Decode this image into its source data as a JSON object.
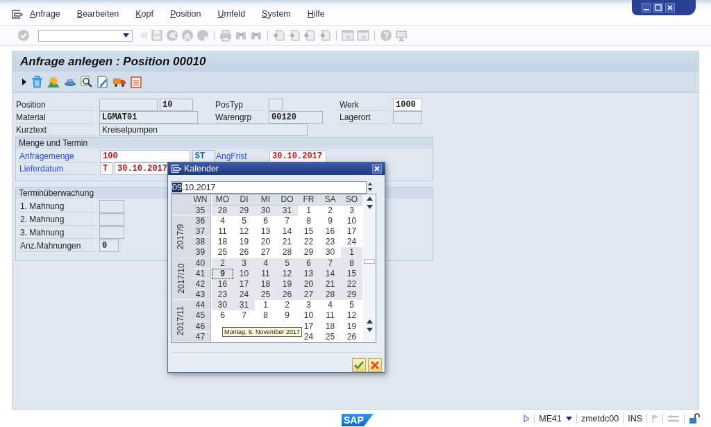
{
  "menu": [
    "Anfrage",
    "Bearbeiten",
    "Kopf",
    "Position",
    "Umfeld",
    "System",
    "Hilfe"
  ],
  "title": "Anfrage anlegen : Position 00010",
  "header": {
    "position": {
      "label": "Position",
      "value": "10"
    },
    "postyp": {
      "label": "PosTyp"
    },
    "werk": {
      "label": "Werk",
      "value": "1000",
      "editable": true
    },
    "material": {
      "label": "Material",
      "value": "LGMAT01"
    },
    "warengrp": {
      "label": "Warengrp",
      "value": "00120"
    },
    "lagerort": {
      "label": "Lagerort"
    },
    "kurztext": {
      "label": "Kurztext",
      "value": "Kreiselpumpen"
    }
  },
  "menge": {
    "title": "Menge und Termin",
    "anfragemenge": {
      "label": "Anfragemenge",
      "value": "100",
      "unit": "ST",
      "required": true
    },
    "angfrist": {
      "label": "AngFrist",
      "value": "30.10.2017",
      "required": true
    },
    "lieferdatum": {
      "label": "Lieferdatum",
      "format": "T",
      "value": "30.10.2017",
      "required": true
    }
  },
  "termin": {
    "title": "Terminüberwachung",
    "rows": [
      {
        "label": "1. Mahnung"
      },
      {
        "label": "2. Mahnung"
      },
      {
        "label": "3. Mahnung"
      },
      {
        "label": "Anz.Mahnungen",
        "value": "0"
      }
    ]
  },
  "calendar": {
    "title": "Kalender",
    "date_selected": "09",
    "date_rest": ".10.2017",
    "headers": [
      "WN",
      "MO",
      "DI",
      "MI",
      "DO",
      "FR",
      "SA",
      "SO"
    ],
    "groups": [
      {
        "weeks": [
          {
            "wn": "35",
            "days": [
              {
                "d": "28",
                "shaded": true,
                "selected": false
              },
              {
                "d": "29",
                "shaded": true,
                "selected": false
              },
              {
                "d": "30",
                "shaded": true,
                "selected": false
              },
              {
                "d": "31",
                "shaded": true,
                "selected": false
              },
              {
                "d": "1",
                "shaded": false,
                "selected": false
              },
              {
                "d": "2",
                "shaded": false,
                "selected": false
              },
              {
                "d": "3",
                "shaded": false,
                "selected": false
              }
            ]
          }
        ]
      },
      {
        "label": "2017/9",
        "weeks": [
          {
            "wn": "36",
            "days": [
              {
                "d": "4",
                "shaded": false,
                "selected": false
              },
              {
                "d": "5",
                "shaded": false,
                "selected": false
              },
              {
                "d": "6",
                "shaded": false,
                "selected": false
              },
              {
                "d": "7",
                "shaded": false,
                "selected": false
              },
              {
                "d": "8",
                "shaded": false,
                "selected": false
              },
              {
                "d": "9",
                "shaded": false,
                "selected": false
              },
              {
                "d": "10",
                "shaded": false,
                "selected": false
              }
            ]
          },
          {
            "wn": "37",
            "days": [
              {
                "d": "11",
                "shaded": false,
                "selected": false
              },
              {
                "d": "12",
                "shaded": false,
                "selected": false
              },
              {
                "d": "13",
                "shaded": false,
                "selected": false
              },
              {
                "d": "14",
                "shaded": false,
                "selected": false
              },
              {
                "d": "15",
                "shaded": false,
                "selected": false
              },
              {
                "d": "16",
                "shaded": false,
                "selected": false
              },
              {
                "d": "17",
                "shaded": false,
                "selected": false
              }
            ]
          },
          {
            "wn": "38",
            "days": [
              {
                "d": "18",
                "shaded": false,
                "selected": false
              },
              {
                "d": "19",
                "shaded": false,
                "selected": false
              },
              {
                "d": "20",
                "shaded": false,
                "selected": false
              },
              {
                "d": "21",
                "shaded": false,
                "selected": false
              },
              {
                "d": "22",
                "shaded": false,
                "selected": false
              },
              {
                "d": "23",
                "shaded": false,
                "selected": false
              },
              {
                "d": "24",
                "shaded": false,
                "selected": false
              }
            ]
          },
          {
            "wn": "39",
            "days": [
              {
                "d": "25",
                "shaded": false,
                "selected": false
              },
              {
                "d": "26",
                "shaded": false,
                "selected": false
              },
              {
                "d": "27",
                "shaded": false,
                "selected": false
              },
              {
                "d": "28",
                "shaded": false,
                "selected": false
              },
              {
                "d": "29",
                "shaded": false,
                "selected": false
              },
              {
                "d": "30",
                "shaded": false,
                "selected": false
              },
              {
                "d": "1",
                "shaded": true,
                "selected": false
              }
            ]
          }
        ]
      },
      {
        "label": "2017/10",
        "weeks": [
          {
            "wn": "40",
            "days": [
              {
                "d": "2",
                "shaded": true,
                "selected": false
              },
              {
                "d": "3",
                "shaded": true,
                "selected": false
              },
              {
                "d": "4",
                "shaded": true,
                "selected": false
              },
              {
                "d": "5",
                "shaded": true,
                "selected": false
              },
              {
                "d": "6",
                "shaded": true,
                "selected": false
              },
              {
                "d": "7",
                "shaded": true,
                "selected": false
              },
              {
                "d": "8",
                "shaded": true,
                "selected": false
              }
            ]
          },
          {
            "wn": "41",
            "days": [
              {
                "d": "9",
                "shaded": true,
                "selected": true
              },
              {
                "d": "10",
                "shaded": true,
                "selected": false
              },
              {
                "d": "11",
                "shaded": true,
                "selected": false
              },
              {
                "d": "12",
                "shaded": true,
                "selected": false
              },
              {
                "d": "13",
                "shaded": true,
                "selected": false
              },
              {
                "d": "14",
                "shaded": true,
                "selected": false
              },
              {
                "d": "15",
                "shaded": true,
                "selected": false
              }
            ]
          },
          {
            "wn": "42",
            "days": [
              {
                "d": "16",
                "shaded": true,
                "selected": false
              },
              {
                "d": "17",
                "shaded": true,
                "selected": false
              },
              {
                "d": "18",
                "shaded": true,
                "selected": false
              },
              {
                "d": "19",
                "shaded": true,
                "selected": false
              },
              {
                "d": "20",
                "shaded": true,
                "selected": false
              },
              {
                "d": "21",
                "shaded": true,
                "selected": false
              },
              {
                "d": "22",
                "shaded": true,
                "selected": false
              }
            ]
          },
          {
            "wn": "43",
            "days": [
              {
                "d": "23",
                "shaded": true,
                "selected": false
              },
              {
                "d": "24",
                "shaded": true,
                "selected": false
              },
              {
                "d": "25",
                "shaded": true,
                "selected": false
              },
              {
                "d": "26",
                "shaded": true,
                "selected": false
              },
              {
                "d": "27",
                "shaded": true,
                "selected": false
              },
              {
                "d": "28",
                "shaded": true,
                "selected": false
              },
              {
                "d": "29",
                "shaded": true,
                "selected": false
              }
            ]
          }
        ]
      },
      {
        "label": "2017/11",
        "weeks": [
          {
            "wn": "44",
            "days": [
              {
                "d": "30",
                "shaded": true,
                "selected": false
              },
              {
                "d": "31",
                "shaded": true,
                "selected": false
              },
              {
                "d": "1",
                "shaded": false,
                "selected": false
              },
              {
                "d": "2",
                "shaded": false,
                "selected": false
              },
              {
                "d": "3",
                "shaded": false,
                "selected": false
              },
              {
                "d": "4",
                "shaded": false,
                "selected": false
              },
              {
                "d": "5",
                "shaded": false,
                "selected": false
              }
            ]
          },
          {
            "wn": "45",
            "days": [
              {
                "d": "6",
                "shaded": false,
                "selected": false
              },
              {
                "d": "7",
                "shaded": false,
                "selected": false
              },
              {
                "d": "8",
                "shaded": false,
                "selected": false
              },
              {
                "d": "9",
                "shaded": false,
                "selected": false
              },
              {
                "d": "10",
                "shaded": false,
                "selected": false
              },
              {
                "d": "11",
                "shaded": false,
                "selected": false
              },
              {
                "d": "12",
                "shaded": false,
                "selected": false
              }
            ]
          },
          {
            "wn": "46",
            "days": [
              {
                "shaded": false,
                "selected": false
              },
              {
                "shaded": false,
                "selected": false
              },
              {
                "shaded": false,
                "selected": false
              },
              {
                "shaded": false,
                "selected": false
              },
              {
                "d": "17",
                "shaded": false,
                "selected": false
              },
              {
                "d": "18",
                "shaded": false,
                "selected": false
              },
              {
                "d": "19",
                "shaded": false,
                "selected": false
              }
            ]
          },
          {
            "wn": "47",
            "days": [
              {
                "shaded": false,
                "selected": false
              },
              {
                "shaded": false,
                "selected": false
              },
              {
                "shaded": false,
                "selected": false
              },
              {
                "shaded": false,
                "selected": false
              },
              {
                "d": "24",
                "shaded": false,
                "selected": false
              },
              {
                "d": "25",
                "shaded": false,
                "selected": false
              },
              {
                "d": "26",
                "shaded": false,
                "selected": false
              }
            ]
          }
        ]
      }
    ],
    "tooltip": "Montag, 6. November 2017"
  },
  "logo": "SAP",
  "status": {
    "transaction": "ME41",
    "server": "zmetdc00",
    "mode": "INS"
  }
}
